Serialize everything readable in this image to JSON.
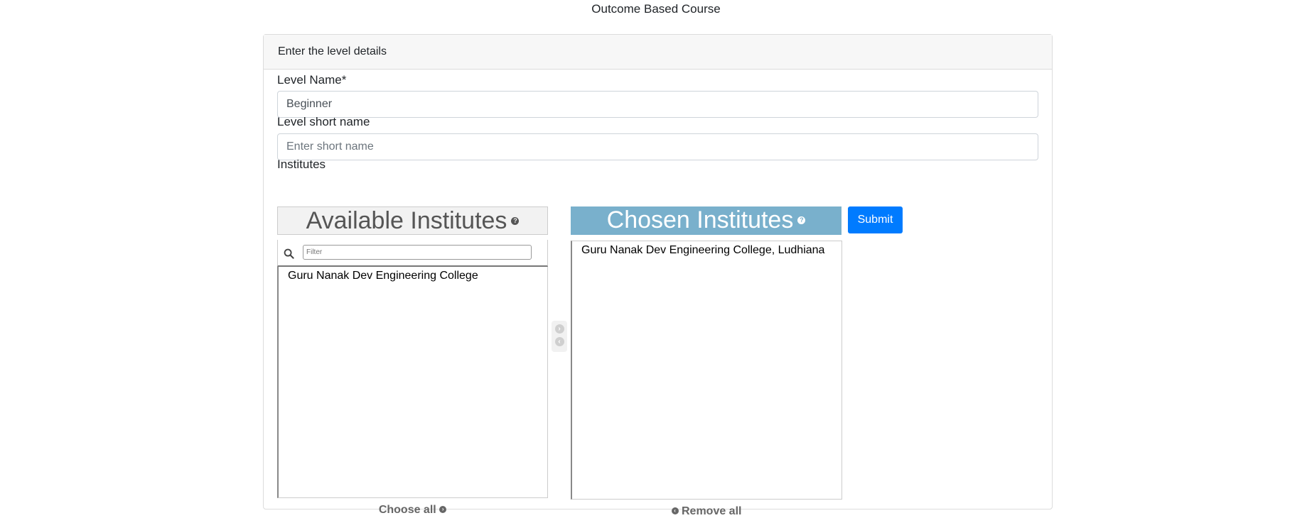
{
  "page": {
    "title": "Outcome Based Course"
  },
  "card": {
    "header": "Enter the level details"
  },
  "form": {
    "level_name_label": "Level Name*",
    "level_name_value": "Beginner",
    "short_name_label": "Level short name",
    "short_name_placeholder": "Enter short name",
    "institutes_label": "Institutes"
  },
  "selector": {
    "available_title": "Available Institutes",
    "chosen_title": "Chosen Institutes",
    "filter_placeholder": "Filter",
    "available_items": [
      "Guru Nanak Dev Engineering College"
    ],
    "chosen_items": [
      "Guru Nanak Dev Engineering College, Ludhiana"
    ],
    "choose_all_label": "Choose all",
    "remove_all_label": "Remove all"
  },
  "actions": {
    "submit_label": "Submit"
  },
  "icons": {
    "help": "help-icon",
    "search": "search-icon",
    "move_right": "arrow-right-circle-icon",
    "move_left": "arrow-left-circle-icon"
  },
  "colors": {
    "primary": "#007bff",
    "chosen_header": "#79b0cc",
    "available_header": "#f2f2f2"
  }
}
